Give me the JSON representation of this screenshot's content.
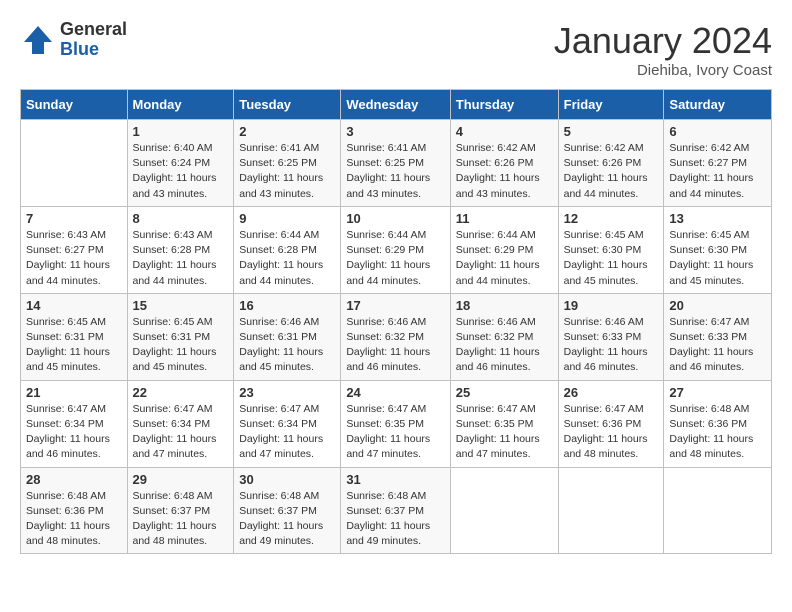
{
  "header": {
    "logo_general": "General",
    "logo_blue": "Blue",
    "month": "January 2024",
    "location": "Diehiba, Ivory Coast"
  },
  "days_of_week": [
    "Sunday",
    "Monday",
    "Tuesday",
    "Wednesday",
    "Thursday",
    "Friday",
    "Saturday"
  ],
  "weeks": [
    [
      {
        "day": "",
        "sunrise": "",
        "sunset": "",
        "daylight": ""
      },
      {
        "day": "1",
        "sunrise": "6:40 AM",
        "sunset": "6:24 PM",
        "daylight": "11 hours and 43 minutes."
      },
      {
        "day": "2",
        "sunrise": "6:41 AM",
        "sunset": "6:25 PM",
        "daylight": "11 hours and 43 minutes."
      },
      {
        "day": "3",
        "sunrise": "6:41 AM",
        "sunset": "6:25 PM",
        "daylight": "11 hours and 43 minutes."
      },
      {
        "day": "4",
        "sunrise": "6:42 AM",
        "sunset": "6:26 PM",
        "daylight": "11 hours and 43 minutes."
      },
      {
        "day": "5",
        "sunrise": "6:42 AM",
        "sunset": "6:26 PM",
        "daylight": "11 hours and 44 minutes."
      },
      {
        "day": "6",
        "sunrise": "6:42 AM",
        "sunset": "6:27 PM",
        "daylight": "11 hours and 44 minutes."
      }
    ],
    [
      {
        "day": "7",
        "sunrise": "6:43 AM",
        "sunset": "6:27 PM",
        "daylight": "11 hours and 44 minutes."
      },
      {
        "day": "8",
        "sunrise": "6:43 AM",
        "sunset": "6:28 PM",
        "daylight": "11 hours and 44 minutes."
      },
      {
        "day": "9",
        "sunrise": "6:44 AM",
        "sunset": "6:28 PM",
        "daylight": "11 hours and 44 minutes."
      },
      {
        "day": "10",
        "sunrise": "6:44 AM",
        "sunset": "6:29 PM",
        "daylight": "11 hours and 44 minutes."
      },
      {
        "day": "11",
        "sunrise": "6:44 AM",
        "sunset": "6:29 PM",
        "daylight": "11 hours and 44 minutes."
      },
      {
        "day": "12",
        "sunrise": "6:45 AM",
        "sunset": "6:30 PM",
        "daylight": "11 hours and 45 minutes."
      },
      {
        "day": "13",
        "sunrise": "6:45 AM",
        "sunset": "6:30 PM",
        "daylight": "11 hours and 45 minutes."
      }
    ],
    [
      {
        "day": "14",
        "sunrise": "6:45 AM",
        "sunset": "6:31 PM",
        "daylight": "11 hours and 45 minutes."
      },
      {
        "day": "15",
        "sunrise": "6:45 AM",
        "sunset": "6:31 PM",
        "daylight": "11 hours and 45 minutes."
      },
      {
        "day": "16",
        "sunrise": "6:46 AM",
        "sunset": "6:31 PM",
        "daylight": "11 hours and 45 minutes."
      },
      {
        "day": "17",
        "sunrise": "6:46 AM",
        "sunset": "6:32 PM",
        "daylight": "11 hours and 46 minutes."
      },
      {
        "day": "18",
        "sunrise": "6:46 AM",
        "sunset": "6:32 PM",
        "daylight": "11 hours and 46 minutes."
      },
      {
        "day": "19",
        "sunrise": "6:46 AM",
        "sunset": "6:33 PM",
        "daylight": "11 hours and 46 minutes."
      },
      {
        "day": "20",
        "sunrise": "6:47 AM",
        "sunset": "6:33 PM",
        "daylight": "11 hours and 46 minutes."
      }
    ],
    [
      {
        "day": "21",
        "sunrise": "6:47 AM",
        "sunset": "6:34 PM",
        "daylight": "11 hours and 46 minutes."
      },
      {
        "day": "22",
        "sunrise": "6:47 AM",
        "sunset": "6:34 PM",
        "daylight": "11 hours and 47 minutes."
      },
      {
        "day": "23",
        "sunrise": "6:47 AM",
        "sunset": "6:34 PM",
        "daylight": "11 hours and 47 minutes."
      },
      {
        "day": "24",
        "sunrise": "6:47 AM",
        "sunset": "6:35 PM",
        "daylight": "11 hours and 47 minutes."
      },
      {
        "day": "25",
        "sunrise": "6:47 AM",
        "sunset": "6:35 PM",
        "daylight": "11 hours and 47 minutes."
      },
      {
        "day": "26",
        "sunrise": "6:47 AM",
        "sunset": "6:36 PM",
        "daylight": "11 hours and 48 minutes."
      },
      {
        "day": "27",
        "sunrise": "6:48 AM",
        "sunset": "6:36 PM",
        "daylight": "11 hours and 48 minutes."
      }
    ],
    [
      {
        "day": "28",
        "sunrise": "6:48 AM",
        "sunset": "6:36 PM",
        "daylight": "11 hours and 48 minutes."
      },
      {
        "day": "29",
        "sunrise": "6:48 AM",
        "sunset": "6:37 PM",
        "daylight": "11 hours and 48 minutes."
      },
      {
        "day": "30",
        "sunrise": "6:48 AM",
        "sunset": "6:37 PM",
        "daylight": "11 hours and 49 minutes."
      },
      {
        "day": "31",
        "sunrise": "6:48 AM",
        "sunset": "6:37 PM",
        "daylight": "11 hours and 49 minutes."
      },
      {
        "day": "",
        "sunrise": "",
        "sunset": "",
        "daylight": ""
      },
      {
        "day": "",
        "sunrise": "",
        "sunset": "",
        "daylight": ""
      },
      {
        "day": "",
        "sunrise": "",
        "sunset": "",
        "daylight": ""
      }
    ]
  ]
}
